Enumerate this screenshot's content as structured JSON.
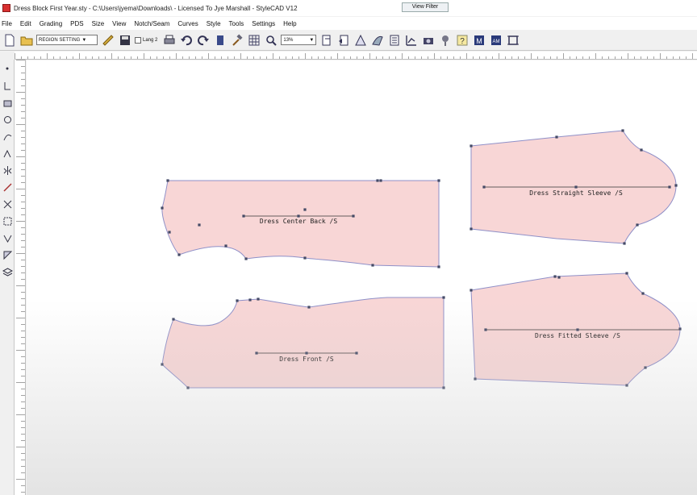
{
  "window": {
    "title": "Dress Block First Year.sty - C:\\Users\\jyema\\Downloads\\ - Licensed To Jye Marshall - StyleCAD V12",
    "view_filter": "View Filter"
  },
  "menu": [
    "File",
    "Edit",
    "Grading",
    "PDS",
    "Size",
    "View",
    "Notch/Seam",
    "Curves",
    "Style",
    "Tools",
    "Settings",
    "Help"
  ],
  "toolbar": {
    "size_select": "REGION SETTING",
    "lang2_label": "Lang 2",
    "zoom_select": "13%"
  },
  "icons": {
    "top": [
      "new-file-icon",
      "open-folder-icon",
      "measure-icon",
      "save-icon",
      "print-icon",
      "undo-icon",
      "redo-icon",
      "book-icon",
      "hammer-icon",
      "grid-icon",
      "zoom-icon",
      "page-icon",
      "page-left-icon",
      "warning-icon",
      "shape-icon",
      "document-icon",
      "chart-icon",
      "camera-icon",
      "pin-icon",
      "help-icon",
      "m-icon",
      "am-icon",
      "frame-icon"
    ],
    "left": [
      "point-tool-icon",
      "line-tool-icon",
      "select-tool-icon",
      "rotate-tool-icon",
      "curve-tool-icon",
      "notch-tool-icon",
      "mirror-tool-icon",
      "cut-tool-icon",
      "grade-tool-icon",
      "seam-tool-icon",
      "dart-tool-icon",
      "fold-tool-icon",
      "layer-tool-icon"
    ]
  },
  "colors": {
    "piece_fill": "#f8d6d6",
    "piece_outline": "#8f90c8",
    "point": "#444a66"
  },
  "pieces": [
    {
      "name": "back",
      "label": "Dress Center Back /S"
    },
    {
      "name": "straight-sleeve",
      "label": "Dress Straight Sleeve /S"
    },
    {
      "name": "front",
      "label": "Dress Front /S"
    },
    {
      "name": "fitted-sleeve",
      "label": "Dress Fitted Sleeve /S"
    }
  ]
}
